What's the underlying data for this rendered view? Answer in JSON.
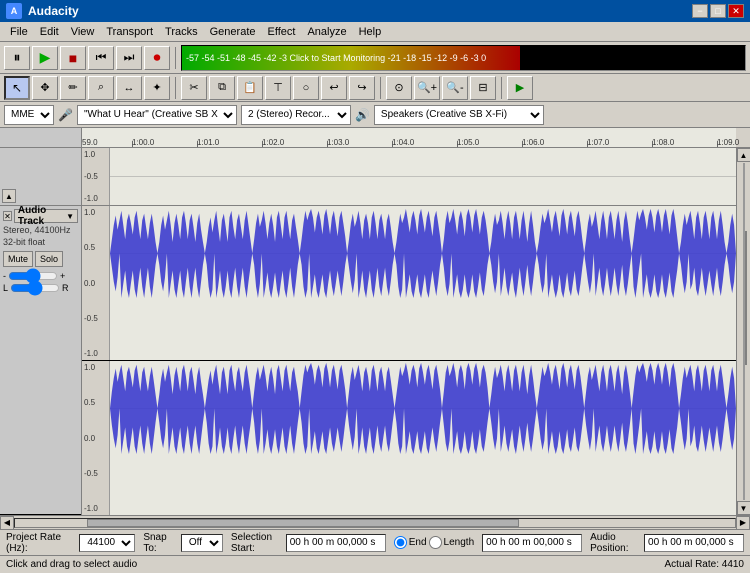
{
  "titlebar": {
    "app_icon": "A",
    "title": "Audacity",
    "minimize": "−",
    "maximize": "□",
    "close": "✕"
  },
  "menubar": {
    "items": [
      "File",
      "Edit",
      "View",
      "Transport",
      "Tracks",
      "Generate",
      "Effect",
      "Analyze",
      "Help"
    ]
  },
  "toolbar1": {
    "pause": "⏸",
    "play": "▶",
    "stop": "■",
    "skip_back": "⏮",
    "skip_forward": "⏭",
    "record": "⏺",
    "level_meter_text": "-57 -54 -51 -48 -45 -42 -3  Click to Start Monitoring  -21 -18 -15 -12 -9 -6 -3 0"
  },
  "toolbar2": {
    "buttons": [
      "↖",
      "✥",
      "✏",
      "♪",
      "✂",
      "…",
      "⟲",
      "⟳"
    ]
  },
  "device_bar": {
    "host": "MME",
    "mic_icon": "🎤",
    "input": "\"What U Hear\" (Creative SB X",
    "channels": "2 (Stereo) Recor...",
    "speaker_icon": "🔊",
    "output": "Speakers (Creative SB X-Fi)"
  },
  "timeline": {
    "markers": [
      "59.0",
      "1:00.0",
      "1:01.0",
      "1:02.0",
      "1:03.0",
      "1:04.0",
      "1:05.0",
      "1:06.0",
      "1:07.0",
      "1:08.0",
      "1:09.0"
    ]
  },
  "empty_track": {
    "y_labels": [
      "1.0",
      "-0.5",
      "-1.0"
    ],
    "scroll_btn": "▲"
  },
  "audio_track": {
    "close": "✕",
    "name": "Audio Track",
    "dropdown": "▼",
    "info_line1": "Stereo, 44100Hz",
    "info_line2": "32-bit float",
    "mute": "Mute",
    "solo": "Solo",
    "gain_minus": "-",
    "gain_plus": "+",
    "left": "L",
    "right": "R",
    "channel1_labels": [
      "1.0",
      "0.5",
      "0.0",
      "-0.5",
      "-1.0"
    ],
    "channel2_labels": [
      "1.0",
      "0.5",
      "0.0",
      "-0.5",
      "-1.0"
    ]
  },
  "status_bar": {
    "project_rate_label": "Project Rate (Hz):",
    "project_rate_value": "44100",
    "snap_to_label": "Snap To:",
    "snap_to_value": "Off",
    "selection_start_label": "Selection Start:",
    "selection_start_value": "00 h 00 m 00,000 s",
    "end_label": "End",
    "length_label": "Length",
    "selection_end_value": "00 h 00 m 00,000 s",
    "audio_position_label": "Audio Position:",
    "audio_position_value": "00 h 00 m 00,000 s"
  },
  "bottom_status": {
    "message": "Click and drag to select audio",
    "actual_rate": "Actual Rate: 4410"
  },
  "colors": {
    "waveform_fill": "#3333cc",
    "waveform_bg": "#e8e8e0",
    "title_bar": "#0050a0"
  }
}
